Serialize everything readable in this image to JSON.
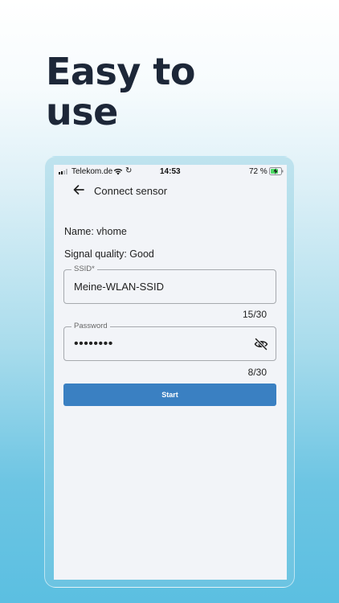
{
  "headline": {
    "line1": "Easy to",
    "line2": "use"
  },
  "status_bar": {
    "carrier": "Telekom.de",
    "time": "14:53",
    "battery": "72 %",
    "signal_bars_filled": 2,
    "signal_bars_total": 4,
    "icons": [
      "signal-icon",
      "wifi-icon",
      "sync-icon",
      "battery-charging-icon"
    ]
  },
  "app_bar": {
    "title": "Connect sensor",
    "back_icon": "arrow-left-icon"
  },
  "sensor": {
    "name": "Name: vhome",
    "signal_quality": "Signal quality: Good"
  },
  "ssid_field": {
    "label": "SSID*",
    "value": "Meine-WLAN-SSID",
    "counter": "15/30"
  },
  "password_field": {
    "label": "Password",
    "masked_value": "••••••••",
    "counter": "8/30",
    "visibility_icon": "eye-off-icon"
  },
  "start_button": {
    "label": "Start"
  },
  "colors": {
    "headline": "#1d2738",
    "accent_button": "#3a80c2",
    "screen_background": "#f2f4f8",
    "background_bottom": "#5bbfe1"
  }
}
